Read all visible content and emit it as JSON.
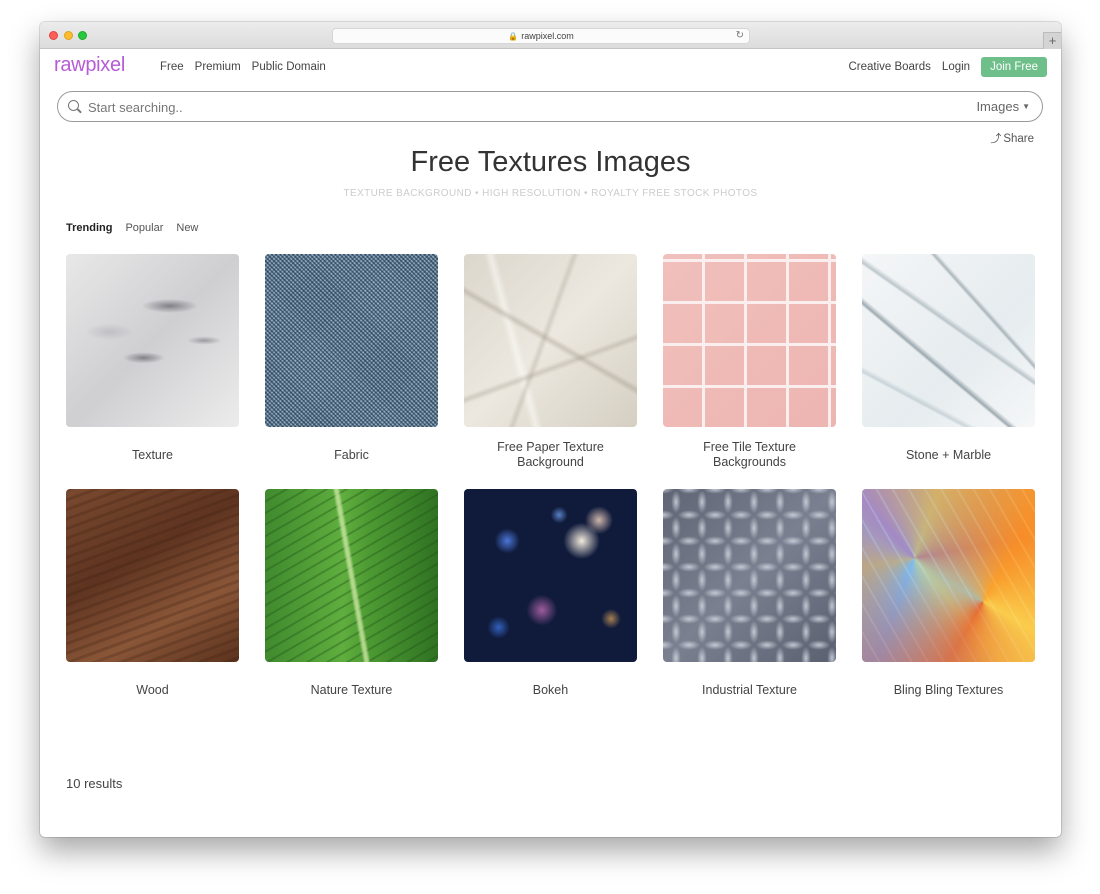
{
  "browser": {
    "url": "rawpixel.com"
  },
  "header": {
    "logo": "rawpixel",
    "nav_left": [
      "Free",
      "Premium",
      "Public Domain"
    ],
    "nav_right": {
      "creative_boards": "Creative Boards",
      "login": "Login",
      "join": "Join Free"
    }
  },
  "search": {
    "placeholder": "Start searching..",
    "type": "Images"
  },
  "share_label": "Share",
  "page_title": "Free Textures Images",
  "subtitle": "TEXTURE BACKGROUND • HIGH RESOLUTION • ROYALTY FREE STOCK PHOTOS",
  "tabs": [
    "Trending",
    "Popular",
    "New"
  ],
  "cards": [
    {
      "label": "Texture"
    },
    {
      "label": "Fabric"
    },
    {
      "label": "Free Paper Texture Background"
    },
    {
      "label": "Free Tile Texture Backgrounds"
    },
    {
      "label": "Stone + Marble"
    },
    {
      "label": "Wood"
    },
    {
      "label": "Nature Texture"
    },
    {
      "label": "Bokeh"
    },
    {
      "label": "Industrial Texture"
    },
    {
      "label": "Bling Bling Textures"
    }
  ],
  "results": "10 results",
  "colors": {
    "brand": "#b75bd6",
    "join_button": "#6fbf8b"
  }
}
